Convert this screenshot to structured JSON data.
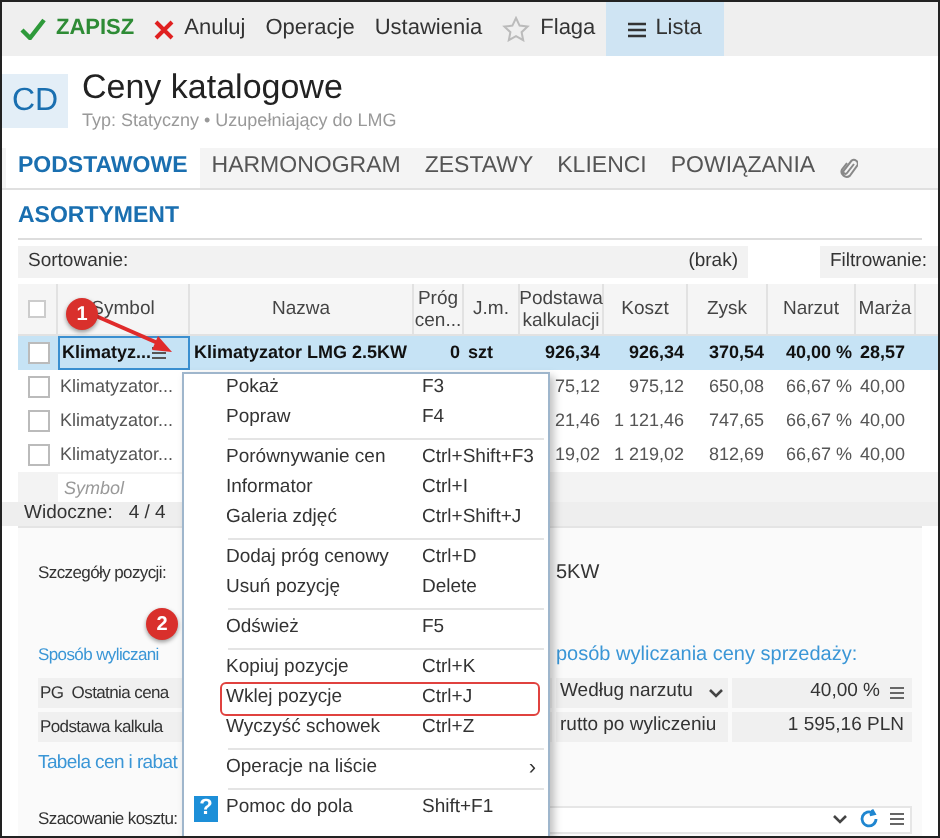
{
  "toolbar": [
    {
      "label": "ZAPISZ",
      "kind": "save",
      "selected": false
    },
    {
      "label": "Anuluj",
      "kind": "cancel",
      "selected": false
    },
    {
      "label": "Operacje",
      "kind": "plain",
      "selected": false
    },
    {
      "label": "Ustawienia",
      "kind": "plain",
      "selected": false
    },
    {
      "label": "Flaga",
      "kind": "flag",
      "selected": false
    },
    {
      "label": "Lista",
      "kind": "list",
      "selected": true
    }
  ],
  "header": {
    "badge": "CD",
    "title": "Ceny katalogowe",
    "subtitle": "Typ: Statyczny • Uzupełniający do LMG"
  },
  "tabs": [
    {
      "label": "PODSTAWOWE",
      "selected": true
    },
    {
      "label": "HARMONOGRAM",
      "selected": false
    },
    {
      "label": "ZESTAWY",
      "selected": false
    },
    {
      "label": "KLIENCI",
      "selected": false
    },
    {
      "label": "POWIĄZANIA",
      "selected": false
    },
    {
      "kind": "attachment",
      "selected": false
    }
  ],
  "section_title": "ASORTYMENT",
  "sorting": {
    "label": "Sortowanie:",
    "value": "(brak)"
  },
  "filtering": {
    "label": "Filtrowanie:"
  },
  "table": {
    "columns": [
      "Symbol",
      "Nazwa",
      "Próg cen...",
      "J.m.",
      "Podstawa kalkulacji",
      "Koszt",
      "Zysk",
      "Narzut",
      "Marża"
    ],
    "rows": [
      {
        "selected": true,
        "checked": false,
        "symbol": "Klimatyz...",
        "nazwa": "Klimatyzator LMG 2.5KW",
        "prog": "0",
        "jm": "szt",
        "podstawa": "926,34",
        "koszt": "926,34",
        "zysk": "370,54",
        "narzut": "40,00 %",
        "marza": "28,57"
      },
      {
        "selected": false,
        "checked": false,
        "symbol": "Klimatyzator...",
        "podstawa": "75,12",
        "koszt": "975,12",
        "zysk": "650,08",
        "narzut": "66,67 %",
        "marza": "40,00"
      },
      {
        "selected": false,
        "checked": false,
        "symbol": "Klimatyzator...",
        "podstawa": "21,46",
        "koszt": "1 121,46",
        "zysk": "747,65",
        "narzut": "66,67 %",
        "marza": "40,00"
      },
      {
        "selected": false,
        "checked": false,
        "symbol": "Klimatyzator...",
        "podstawa": "19,02",
        "koszt": "1 219,02",
        "zysk": "812,69",
        "narzut": "66,67 %",
        "marza": "40,00"
      }
    ],
    "filter_placeholder": "Symbol",
    "select_all_checked": false,
    "visible_label": "Widoczne:",
    "visible_count": "4 / 4"
  },
  "details": {
    "label": "Szczegóły pozycji:",
    "value": "5KW",
    "left_heading": "Sposób wyliczani",
    "right_heading": "posób wyliczania ceny sprzedaży:",
    "left_field_1": "PG  Ostatnia cena",
    "method": "Według narzutu",
    "markup": "40,00 %",
    "left_field_2": "Podstawa kalkula",
    "gross_label": "rutto po wyliczeniu",
    "gross_value": "1 595,16 PLN",
    "table_heading": "Tabela cen i rabat",
    "cost_label": "Szacowanie kosztu:"
  },
  "context_menu": [
    {
      "kind": "item",
      "label": "Pokaż",
      "shortcut": "F3",
      "highlighted": false
    },
    {
      "kind": "item",
      "label": "Popraw",
      "shortcut": "F4",
      "highlighted": false
    },
    {
      "kind": "separator"
    },
    {
      "kind": "item",
      "label": "Porównywanie cen",
      "shortcut": "Ctrl+Shift+F3",
      "highlighted": false
    },
    {
      "kind": "item",
      "label": "Informator",
      "shortcut": "Ctrl+I",
      "highlighted": false
    },
    {
      "kind": "item",
      "label": "Galeria zdjęć",
      "shortcut": "Ctrl+Shift+J",
      "highlighted": false
    },
    {
      "kind": "separator"
    },
    {
      "kind": "item",
      "label": "Dodaj próg cenowy",
      "shortcut": "Ctrl+D",
      "highlighted": false
    },
    {
      "kind": "item",
      "label": "Usuń pozycję",
      "shortcut": "Delete",
      "highlighted": false
    },
    {
      "kind": "separator"
    },
    {
      "kind": "item",
      "label": "Odśwież",
      "shortcut": "F5",
      "highlighted": false
    },
    {
      "kind": "separator"
    },
    {
      "kind": "item",
      "label": "Kopiuj pozycje",
      "shortcut": "Ctrl+K",
      "highlighted": false
    },
    {
      "kind": "item",
      "label": "Wklej pozycje",
      "shortcut": "Ctrl+J",
      "highlighted": true
    },
    {
      "kind": "item",
      "label": "Wyczyść schowek",
      "shortcut": "Ctrl+Z",
      "highlighted": false
    },
    {
      "kind": "separator"
    },
    {
      "kind": "submenu",
      "label": "Operacje na liście",
      "arrow": "›",
      "highlighted": false
    },
    {
      "kind": "separator"
    },
    {
      "kind": "help",
      "icon": "?",
      "label": "Pomoc do pola",
      "shortcut": "Shift+F1",
      "highlighted": false
    }
  ],
  "callouts": [
    "1",
    "2"
  ]
}
